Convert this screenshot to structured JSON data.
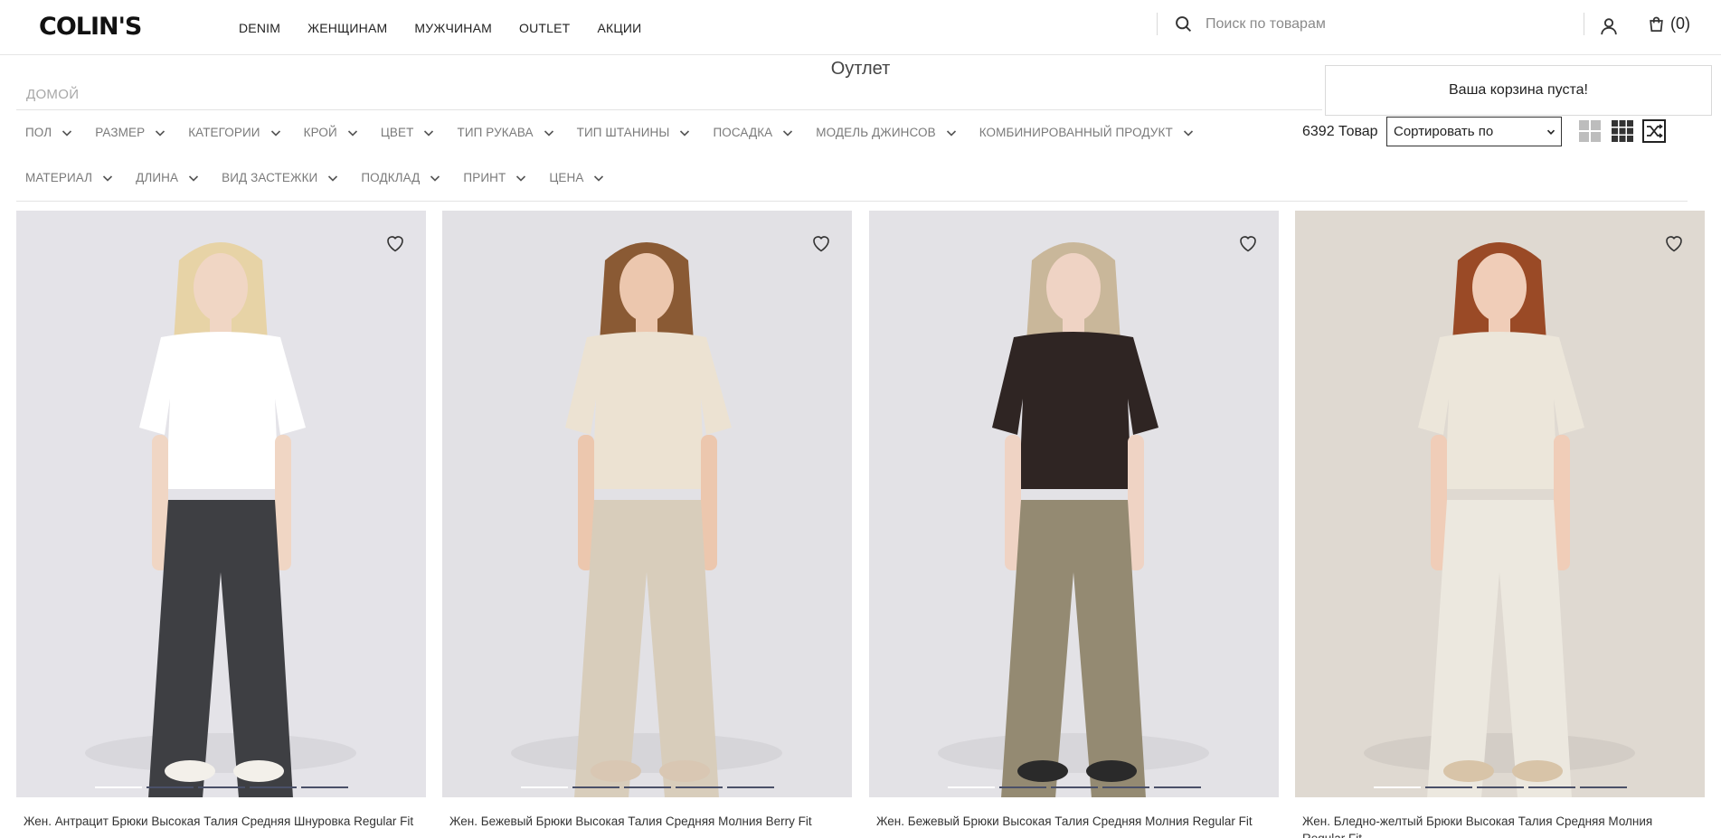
{
  "header": {
    "logo": "COLIN'S",
    "nav": [
      "DENIM",
      "ЖЕНЩИНАМ",
      "МУЖЧИНАМ",
      "OUTLET",
      "АКЦИИ"
    ],
    "search_placeholder": "Поиск по товарам",
    "cart_count": "(0)"
  },
  "page": {
    "title": "Оутлет",
    "breadcrumb": "ДОМОЙ",
    "cart_popup": "Ваша корзина пуста!"
  },
  "filters": {
    "row1": [
      "ПОЛ",
      "РАЗМЕР",
      "КАТЕГОРИИ",
      "КРОЙ",
      "ЦВЕТ",
      "ТИП РУКАВА",
      "ТИП ШТАНИНЫ",
      "ПОСАДКА",
      "МОДЕЛЬ ДЖИНСОВ",
      "КОМБИНИРОВАННЫЙ ПРОДУКТ"
    ],
    "row2": [
      "МАТЕРИАЛ",
      "ДЛИНА",
      "ВИД ЗАСТЕЖКИ",
      "ПОДКЛАД",
      "ПРИНТ",
      "ЦЕНА"
    ]
  },
  "toolbar": {
    "count": "6392 Товар",
    "sort_label": "Сортировать по"
  },
  "products": [
    {
      "name": "Жен. Антрацит Брюки Высокая Талия Средняя Шнуровка Regular Fit",
      "bg": "#e4e3e8",
      "top": "#ffffff",
      "bottom": "#3e3f43",
      "hair": "#e7d3a6",
      "skin": "#f0d6c4",
      "shoes": "#f3f0ea"
    },
    {
      "name": "Жен. Бежевый Брюки Высокая Талия Средняя Молния Berry Fit",
      "bg": "#e2e1e5",
      "top": "#ece2d2",
      "bottom": "#d8cdbb",
      "hair": "#8a5a34",
      "skin": "#ecc7ae",
      "shoes": "#d9c7b3"
    },
    {
      "name": "Жен. Бежевый Брюки Высокая Талия Средняя Молния Regular Fit",
      "bg": "#e3e2e6",
      "top": "#2f2523",
      "bottom": "#948a72",
      "hair": "#c9b79a",
      "skin": "#efd3c4",
      "shoes": "#2a2a2a"
    },
    {
      "name": "Жен. Бледно-желтый Брюки Высокая Талия Средняя Молния Regular Fit",
      "bg": "#dfd9d1",
      "top": "#ece6da",
      "bottom": "#ece8df",
      "hair": "#9a4a26",
      "skin": "#f0cdb8",
      "shoes": "#d8c4a8"
    }
  ]
}
